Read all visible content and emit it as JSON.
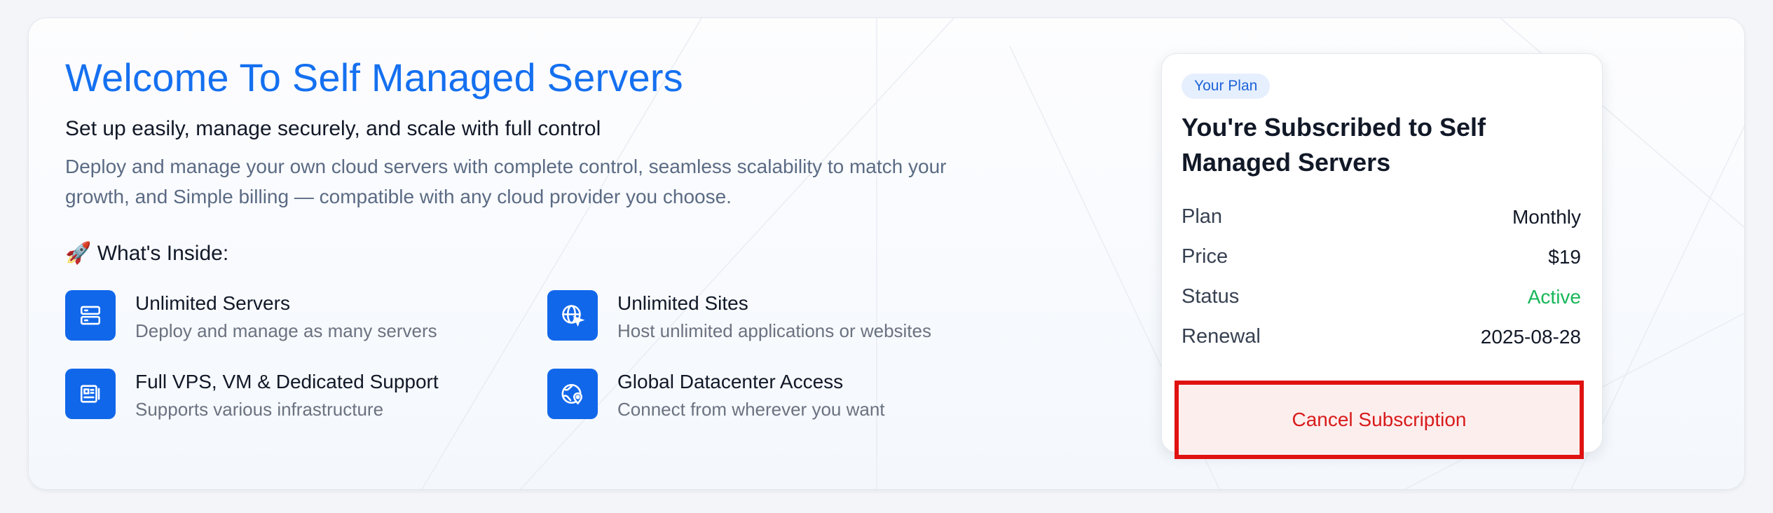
{
  "hero": {
    "title": "Welcome To Self Managed Servers",
    "tagline": "Set up easily, manage securely, and scale with full control",
    "description": "Deploy and manage your own cloud servers with complete control, seamless scalability to match your growth, and Simple billing — compatible with any cloud provider you choose.",
    "inside_title": "🚀 What's Inside:"
  },
  "features": [
    {
      "icon": "server-icon",
      "title": "Unlimited Servers",
      "desc": "Deploy and manage as many servers"
    },
    {
      "icon": "globe-cursor-icon",
      "title": "Unlimited Sites",
      "desc": "Host unlimited applications or websites"
    },
    {
      "icon": "infrastructure-icon",
      "title": "Full VPS, VM & Dedicated Support",
      "desc": "Supports various infrastructure"
    },
    {
      "icon": "globe-pin-icon",
      "title": "Global Datacenter Access",
      "desc": "Connect from wherever you want"
    }
  ],
  "plan_card": {
    "badge": "Your Plan",
    "title": "You're Subscribed to Self Managed Servers",
    "rows": [
      {
        "label": "Plan",
        "value": "Monthly"
      },
      {
        "label": "Price",
        "value": "$19"
      },
      {
        "label": "Status",
        "value": "Active"
      },
      {
        "label": "Renewal",
        "value": "2025-08-28"
      }
    ],
    "cancel_label": "Cancel Subscription"
  },
  "colors": {
    "accent": "#1570f0",
    "icon_bg": "#1167ea",
    "status_active": "#18b75a",
    "cancel_text": "#d81b1b",
    "highlight_border": "#e01111"
  }
}
